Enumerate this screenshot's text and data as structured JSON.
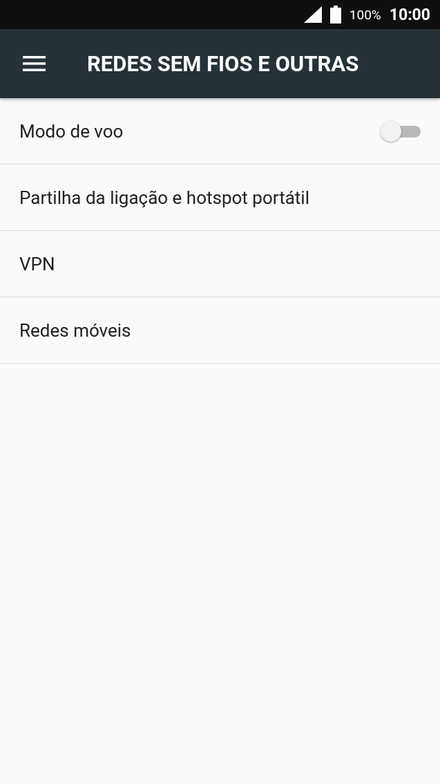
{
  "status_bar": {
    "battery": "100%",
    "time": "10:00"
  },
  "app_bar": {
    "title": "REDES SEM FIOS E OUTRAS"
  },
  "items": [
    {
      "kind": "toggle",
      "label": "Modo de voo",
      "on": false
    },
    {
      "kind": "link",
      "label": "Partilha da ligação e hotspot portátil"
    },
    {
      "kind": "link",
      "label": "VPN"
    },
    {
      "kind": "link",
      "label": "Redes móveis"
    }
  ]
}
